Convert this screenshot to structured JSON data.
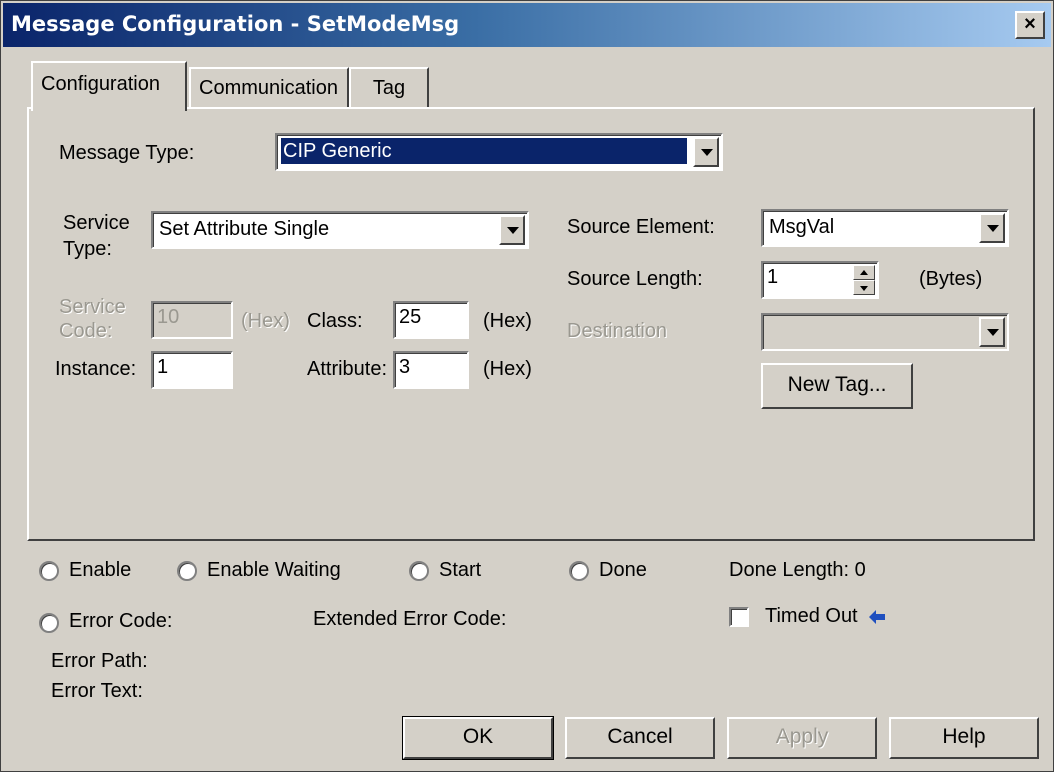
{
  "window": {
    "title": "Message Configuration - SetModeMsg",
    "close_glyph": "×"
  },
  "tabs": [
    {
      "label": "Configuration",
      "active": true
    },
    {
      "label": "Communication",
      "active": false
    },
    {
      "label": "Tag",
      "active": false
    }
  ],
  "config": {
    "message_type_label": "Message Type:",
    "message_type_value": "CIP Generic",
    "service_type_label_1": "Service",
    "service_type_label_2": "Type:",
    "service_type_value": "Set Attribute Single",
    "service_code_label_1": "Service",
    "service_code_label_2": "Code:",
    "service_code_value": "10",
    "service_code_unit": "(Hex)",
    "class_label": "Class:",
    "class_value": "25",
    "class_unit": "(Hex)",
    "instance_label": "Instance:",
    "instance_value": "1",
    "attribute_label": "Attribute:",
    "attribute_value": "3",
    "attribute_unit": "(Hex)",
    "source_element_label": "Source Element:",
    "source_element_value": "MsgVal",
    "source_length_label": "Source Length:",
    "source_length_value": "1",
    "source_length_unit": "(Bytes)",
    "destination_label": "Destination",
    "destination_value": "",
    "new_tag_label": "New Tag..."
  },
  "status": {
    "enable": "Enable",
    "enable_waiting": "Enable Waiting",
    "start": "Start",
    "done": "Done",
    "done_length": "Done Length: 0",
    "error_code": "Error Code:",
    "extended_error_code": "Extended Error Code:",
    "timed_out": "Timed Out",
    "error_path": "Error Path:",
    "error_text": "Error Text:"
  },
  "buttons": {
    "ok": "OK",
    "cancel": "Cancel",
    "apply": "Apply",
    "help": "Help"
  },
  "colors": {
    "selection": "#0a246a",
    "face": "#d4d0c8",
    "arrow": "#1f4fbf"
  }
}
